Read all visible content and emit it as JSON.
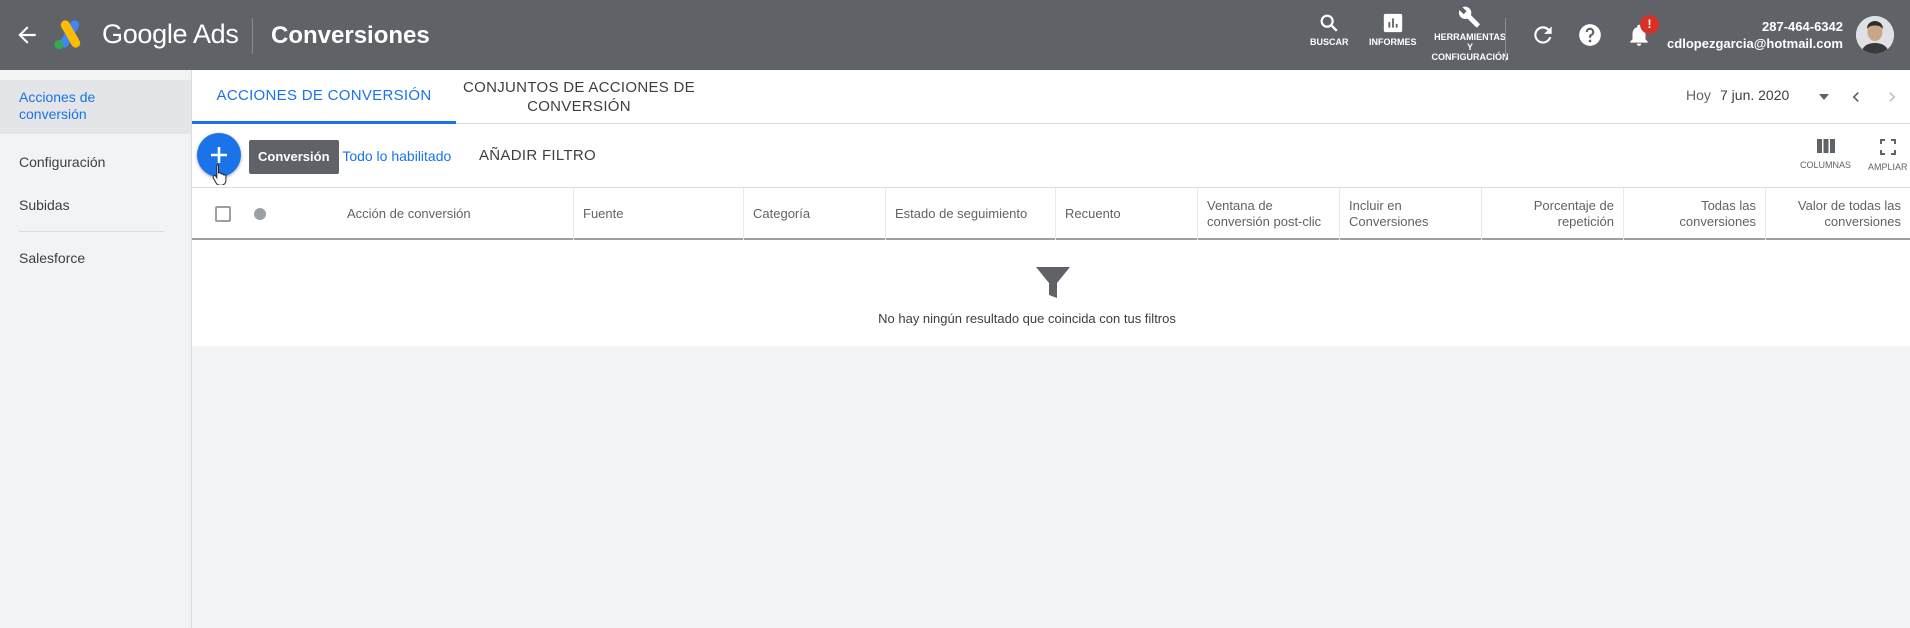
{
  "topbar": {
    "brand": "Google Ads",
    "title": "Conversiones",
    "tools": [
      {
        "label": "BUSCAR",
        "icon": "search-icon"
      },
      {
        "label": "INFORMES",
        "icon": "bar-chart-icon"
      },
      {
        "label": "HERRAMIENTAS Y CONFIGURACIÓN",
        "icon": "wrench-icon"
      }
    ],
    "notification_badge": "!",
    "account_id": "287-464-6342",
    "account_email": "cdlopezgarcia@hotmail.com",
    "colors": {
      "bar": "#5f6368",
      "badge": "#d93025"
    }
  },
  "sidebar": {
    "items": [
      {
        "label": "Acciones de conversión",
        "active": true
      },
      {
        "label": "Configuración",
        "active": false
      },
      {
        "label": "Subidas",
        "active": false
      },
      {
        "label": "Salesforce",
        "active": false
      }
    ]
  },
  "tabs": [
    {
      "label": "ACCIONES DE CONVERSIÓN",
      "active": true
    },
    {
      "label": "CONJUNTOS DE ACCIONES DE CONVERSIÓN",
      "active": false
    }
  ],
  "date": {
    "range_label": "Hoy",
    "value": "7 jun. 2020"
  },
  "toolbar": {
    "tooltip": "Conversión",
    "filter_label": "o: Todo lo habilitado",
    "add_filter": "AÑADIR FILTRO",
    "columns": "COLUMNAS",
    "expand": "AMPLIAR"
  },
  "table": {
    "columns": [
      "Acción de conversión",
      "Fuente",
      "Categoría",
      "Estado de seguimiento",
      "Recuento",
      "Ventana de conversión post-clic",
      "Incluir en Conversiones",
      "Porcentaje de repetición",
      "Todas las conversiones",
      "Valor de todas las conversiones"
    ],
    "empty_message": "No hay ningún resultado que coincida con tus filtros"
  },
  "accent_color": "#1a73e8"
}
